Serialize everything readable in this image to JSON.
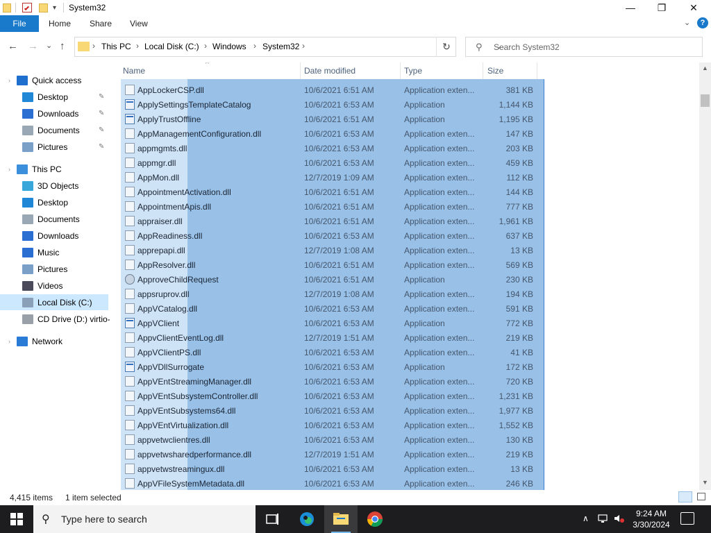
{
  "window": {
    "title": "System32",
    "controls": {
      "minimize": "—",
      "maximize": "❐",
      "close": "✕"
    }
  },
  "ribbon": {
    "tabs": [
      "File",
      "Home",
      "Share",
      "View"
    ],
    "expand_chevron": "⌄",
    "help": "?"
  },
  "address": {
    "crumbs": [
      "This PC",
      "Local Disk (C:)",
      "Windows",
      "System32"
    ],
    "dropdown_glyph": "⌄",
    "refresh_glyph": "↻"
  },
  "search": {
    "placeholder": "Search System32"
  },
  "nav": {
    "back": "←",
    "forward": "→",
    "recent": "⌄",
    "up": "↑",
    "items": [
      {
        "label": "Quick access",
        "icon": "star-icon",
        "color": "#1f6fcf",
        "indent": 0,
        "pinned": false
      },
      {
        "label": "Desktop",
        "icon": "desktop-icon",
        "color": "#1f87d6",
        "indent": 1,
        "pinned": true
      },
      {
        "label": "Downloads",
        "icon": "download-icon",
        "color": "#2a6fd1",
        "indent": 1,
        "pinned": true
      },
      {
        "label": "Documents",
        "icon": "document-icon",
        "color": "#9aa7b5",
        "indent": 1,
        "pinned": true
      },
      {
        "label": "Pictures",
        "icon": "pictures-icon",
        "color": "#7aa0c8",
        "indent": 1,
        "pinned": true
      },
      {
        "label": "This PC",
        "icon": "computer-icon",
        "color": "#3b8fdb",
        "indent": 0,
        "pinned": false
      },
      {
        "label": "3D Objects",
        "icon": "cube-icon",
        "color": "#39a7d9",
        "indent": 1,
        "pinned": false
      },
      {
        "label": "Desktop",
        "icon": "desktop-icon",
        "color": "#1f87d6",
        "indent": 1,
        "pinned": false
      },
      {
        "label": "Documents",
        "icon": "document-icon",
        "color": "#9aa7b5",
        "indent": 1,
        "pinned": false
      },
      {
        "label": "Downloads",
        "icon": "download-icon",
        "color": "#2a6fd1",
        "indent": 1,
        "pinned": false
      },
      {
        "label": "Music",
        "icon": "music-icon",
        "color": "#2a6fd1",
        "indent": 1,
        "pinned": false
      },
      {
        "label": "Pictures",
        "icon": "pictures-icon",
        "color": "#7aa0c8",
        "indent": 1,
        "pinned": false
      },
      {
        "label": "Videos",
        "icon": "video-icon",
        "color": "#4a4a5a",
        "indent": 1,
        "pinned": false
      },
      {
        "label": "Local Disk (C:)",
        "icon": "drive-icon",
        "color": "#8aa0b8",
        "indent": 1,
        "pinned": false,
        "selected": true
      },
      {
        "label": "CD Drive (D:) virtio-",
        "icon": "cd-drive-icon",
        "color": "#9aa0a8",
        "indent": 1,
        "pinned": false
      },
      {
        "label": "Network",
        "icon": "network-icon",
        "color": "#2a7bd6",
        "indent": 0,
        "pinned": false
      }
    ]
  },
  "columns": {
    "name": "Name",
    "date": "Date modified",
    "type": "Type",
    "size": "Size"
  },
  "files": [
    {
      "name": "AppLockerCSP.dll",
      "date": "10/6/2021 6:51 AM",
      "type": "Application exten...",
      "size": "381 KB",
      "icon": "dll-file-icon"
    },
    {
      "name": "ApplySettingsTemplateCatalog",
      "date": "10/6/2021 6:53 AM",
      "type": "Application",
      "size": "1,144 KB",
      "icon": "exe-file-icon"
    },
    {
      "name": "ApplyTrustOffline",
      "date": "10/6/2021 6:51 AM",
      "type": "Application",
      "size": "1,195 KB",
      "icon": "exe-file-icon"
    },
    {
      "name": "AppManagementConfiguration.dll",
      "date": "10/6/2021 6:53 AM",
      "type": "Application exten...",
      "size": "147 KB",
      "icon": "dll-file-icon"
    },
    {
      "name": "appmgmts.dll",
      "date": "10/6/2021 6:53 AM",
      "type": "Application exten...",
      "size": "203 KB",
      "icon": "dll-file-icon"
    },
    {
      "name": "appmgr.dll",
      "date": "10/6/2021 6:53 AM",
      "type": "Application exten...",
      "size": "459 KB",
      "icon": "dll-file-icon"
    },
    {
      "name": "AppMon.dll",
      "date": "12/7/2019 1:09 AM",
      "type": "Application exten...",
      "size": "112 KB",
      "icon": "dll-file-icon"
    },
    {
      "name": "AppointmentActivation.dll",
      "date": "10/6/2021 6:51 AM",
      "type": "Application exten...",
      "size": "144 KB",
      "icon": "dll-file-icon"
    },
    {
      "name": "AppointmentApis.dll",
      "date": "10/6/2021 6:51 AM",
      "type": "Application exten...",
      "size": "777 KB",
      "icon": "dll-file-icon"
    },
    {
      "name": "appraiser.dll",
      "date": "10/6/2021 6:51 AM",
      "type": "Application exten...",
      "size": "1,961 KB",
      "icon": "dll-file-icon"
    },
    {
      "name": "AppReadiness.dll",
      "date": "10/6/2021 6:53 AM",
      "type": "Application exten...",
      "size": "637 KB",
      "icon": "dll-file-icon"
    },
    {
      "name": "apprepapi.dll",
      "date": "12/7/2019 1:08 AM",
      "type": "Application exten...",
      "size": "13 KB",
      "icon": "dll-file-icon"
    },
    {
      "name": "AppResolver.dll",
      "date": "10/6/2021 6:51 AM",
      "type": "Application exten...",
      "size": "569 KB",
      "icon": "dll-file-icon"
    },
    {
      "name": "ApproveChildRequest",
      "date": "10/6/2021 6:51 AM",
      "type": "Application",
      "size": "230 KB",
      "icon": "settings-app-icon"
    },
    {
      "name": "appsruprov.dll",
      "date": "12/7/2019 1:08 AM",
      "type": "Application exten...",
      "size": "194 KB",
      "icon": "dll-file-icon"
    },
    {
      "name": "AppVCatalog.dll",
      "date": "10/6/2021 6:53 AM",
      "type": "Application exten...",
      "size": "591 KB",
      "icon": "dll-file-icon"
    },
    {
      "name": "AppVClient",
      "date": "10/6/2021 6:53 AM",
      "type": "Application",
      "size": "772 KB",
      "icon": "exe-file-icon"
    },
    {
      "name": "AppvClientEventLog.dll",
      "date": "12/7/2019 1:51 AM",
      "type": "Application exten...",
      "size": "219 KB",
      "icon": "dll-file-icon"
    },
    {
      "name": "AppVClientPS.dll",
      "date": "10/6/2021 6:53 AM",
      "type": "Application exten...",
      "size": "41 KB",
      "icon": "dll-file-icon"
    },
    {
      "name": "AppVDllSurrogate",
      "date": "10/6/2021 6:53 AM",
      "type": "Application",
      "size": "172 KB",
      "icon": "exe-file-icon"
    },
    {
      "name": "AppVEntStreamingManager.dll",
      "date": "10/6/2021 6:53 AM",
      "type": "Application exten...",
      "size": "720 KB",
      "icon": "dll-file-icon"
    },
    {
      "name": "AppVEntSubsystemController.dll",
      "date": "10/6/2021 6:53 AM",
      "type": "Application exten...",
      "size": "1,231 KB",
      "icon": "dll-file-icon"
    },
    {
      "name": "AppVEntSubsystems64.dll",
      "date": "10/6/2021 6:53 AM",
      "type": "Application exten...",
      "size": "1,977 KB",
      "icon": "dll-file-icon"
    },
    {
      "name": "AppVEntVirtualization.dll",
      "date": "10/6/2021 6:53 AM",
      "type": "Application exten...",
      "size": "1,552 KB",
      "icon": "dll-file-icon"
    },
    {
      "name": "appvetwclientres.dll",
      "date": "10/6/2021 6:53 AM",
      "type": "Application exten...",
      "size": "130 KB",
      "icon": "dll-file-icon"
    },
    {
      "name": "appvetwsharedperformance.dll",
      "date": "12/7/2019 1:51 AM",
      "type": "Application exten...",
      "size": "219 KB",
      "icon": "dll-file-icon"
    },
    {
      "name": "appvetwstreamingux.dll",
      "date": "10/6/2021 6:53 AM",
      "type": "Application exten...",
      "size": "13 KB",
      "icon": "dll-file-icon"
    },
    {
      "name": "AppVFileSystemMetadata.dll",
      "date": "10/6/2021 6:53 AM",
      "type": "Application exten...",
      "size": "246 KB",
      "icon": "dll-file-icon"
    }
  ],
  "status": {
    "item_count": "4,415 items",
    "selection": "1 item selected"
  },
  "taskbar": {
    "search_placeholder": "Type here to search",
    "apps": [
      "task-view-icon",
      "edge-icon",
      "file-explorer-icon",
      "chrome-icon"
    ],
    "time": "9:24 AM",
    "date": "3/30/2024"
  },
  "colors": {
    "accent": "#1979ca",
    "selection": "#99c1e8",
    "folder": "#f8d775",
    "taskbar": "#1d1d1f"
  }
}
